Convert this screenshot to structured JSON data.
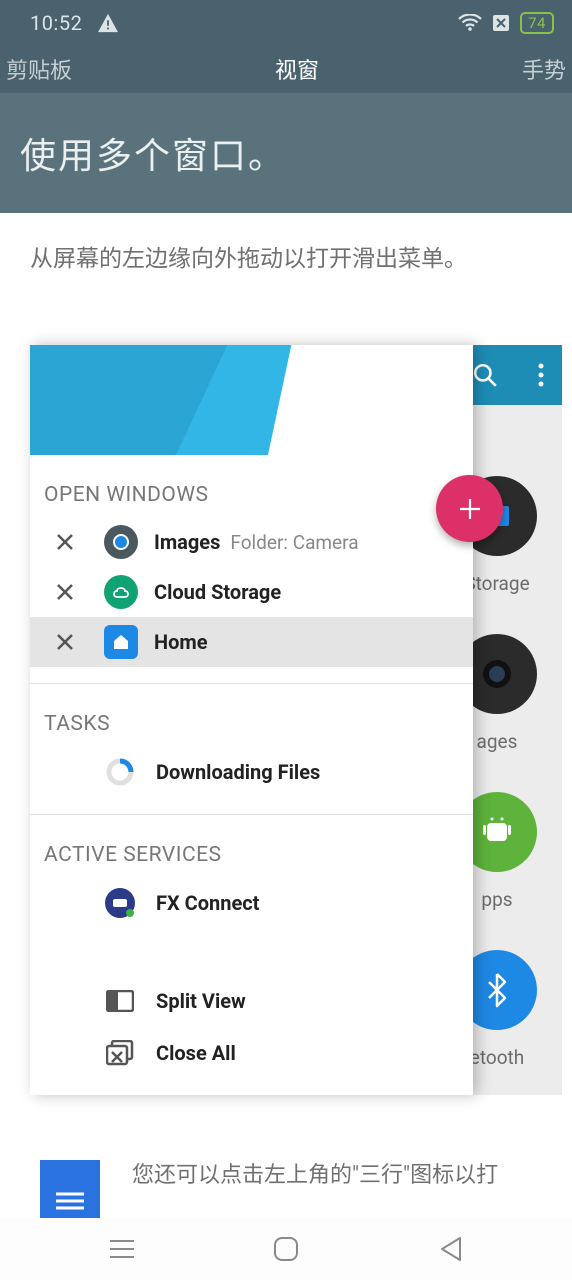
{
  "status": {
    "time": "10:52",
    "battery": "74"
  },
  "tabs": {
    "left": "剪贴板",
    "center": "视窗",
    "right": "手势"
  },
  "hero": "使用多个窗口。",
  "intro": "从屏幕的左边缘向外拖动以打开滑出菜单。",
  "drawer": {
    "open_windows_title": "OPEN WINDOWS",
    "windows": [
      {
        "label": "Images",
        "sub": "Folder: Camera"
      },
      {
        "label": "Cloud Storage",
        "sub": ""
      },
      {
        "label": "Home",
        "sub": ""
      }
    ],
    "tasks_title": "TASKS",
    "tasks": [
      {
        "label": "Downloading Files"
      }
    ],
    "services_title": "ACTIVE SERVICES",
    "services": [
      {
        "label": "FX Connect"
      }
    ],
    "actions": {
      "split": "Split View",
      "close_all": "Close All"
    }
  },
  "behind": {
    "items": [
      {
        "label": "Storage",
        "color": "#222"
      },
      {
        "label": "ages",
        "color": "#222"
      },
      {
        "label": "pps",
        "color": "#5DB33B"
      },
      {
        "label": "etooth",
        "color": "#1E88E5"
      }
    ]
  },
  "hint": "您还可以点击左上角的\"三行\"图标以打"
}
